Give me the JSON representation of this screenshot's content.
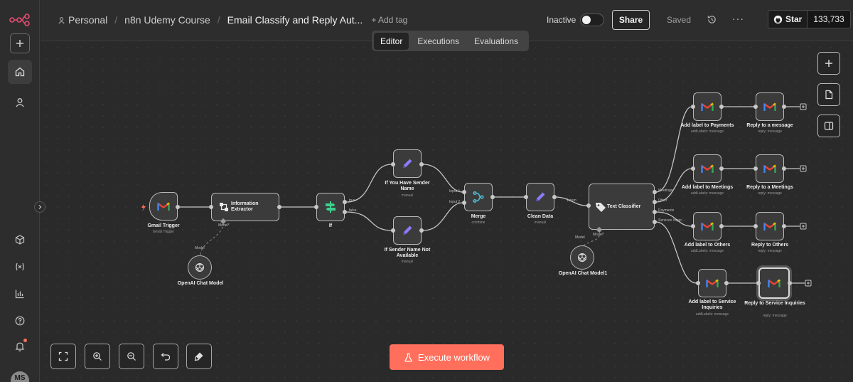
{
  "header": {
    "breadcrumbs": [
      "Personal",
      "n8n Udemy Course",
      "Email Classify and Reply Aut..."
    ],
    "add_tag": "+ Add tag",
    "status": "Inactive",
    "share": "Share",
    "saved": "Saved",
    "github": {
      "star": "Star",
      "count": "133,733"
    }
  },
  "tabs": [
    {
      "label": "Editor",
      "active": true
    },
    {
      "label": "Executions",
      "active": false
    },
    {
      "label": "Evaluations",
      "active": false
    }
  ],
  "sidebar": {
    "avatar_initials": "MS"
  },
  "nodes": {
    "gmail_trigger": {
      "label": "Gmail Trigger",
      "sub": "Gmail Trigger"
    },
    "info_extractor": {
      "label": "Information Extractor",
      "port_label": "Model*"
    },
    "openai_model": {
      "label": "OpenAI Chat Model",
      "port_label": "Model"
    },
    "if_node": {
      "label": "If",
      "true_label": "true",
      "false_label": "false"
    },
    "sender_name": {
      "label": "If You Have Sender Name",
      "sub": "manual"
    },
    "sender_na": {
      "label": "If Sender Name Not Available",
      "sub": "manual"
    },
    "merge": {
      "label": "Merge",
      "sub": "combine",
      "input1": "Input 1",
      "input2": "Input 2"
    },
    "clean_data": {
      "label": "Clean Data",
      "sub": "manual",
      "out_label": "1 item"
    },
    "text_classifier": {
      "label": "Text Classifier",
      "port_label": "Model*",
      "outputs": [
        "Meetings",
        "Other",
        "Payments",
        "Services Inquir..."
      ]
    },
    "openai_model1": {
      "label": "OpenAI Chat Model1",
      "port_label": "Model"
    },
    "label_payments": {
      "label": "Add label to Payments",
      "sub": "addLabels: message"
    },
    "reply_message": {
      "label": "Reply to a message",
      "sub": "reply: message"
    },
    "label_meetings": {
      "label": "Add label to Meetings",
      "sub": "addLabels: message"
    },
    "reply_meetings": {
      "label": "Reply to a Meetings",
      "sub": "reply: message"
    },
    "label_others": {
      "label": "Add label to Others",
      "sub": "addLabels: message"
    },
    "reply_others": {
      "label": "Reply to Others",
      "sub": "reply: message"
    },
    "label_service": {
      "label": "Add label to Service Inquiries",
      "sub": "addLabels: message"
    },
    "reply_service": {
      "label": "Reply to Service Inquiries",
      "sub": "reply: message"
    }
  },
  "execute_button": "Execute workflow",
  "colors": {
    "accent": "#ff6f5c",
    "canvas": "#2a2a2a",
    "node": "#3b3b3b",
    "if_green": "#3ecf8e",
    "edit_purple": "#8b7cf6",
    "merge_teal": "#4fc3dc"
  },
  "icons": [
    "n8n-logo-icon",
    "plus-icon",
    "home-icon",
    "user-icon",
    "package-icon",
    "variables-icon",
    "insights-icon",
    "help-icon",
    "bell-icon",
    "history-icon",
    "more-icon",
    "github-icon",
    "gmail-icon",
    "tag-icon",
    "pen-icon",
    "merge-icon",
    "if-icon",
    "openai-icon",
    "sticky-note-icon",
    "panel-icon",
    "fit-view-icon",
    "zoom-in-icon",
    "zoom-out-icon",
    "undo-icon",
    "clear-icon",
    "flask-icon"
  ]
}
